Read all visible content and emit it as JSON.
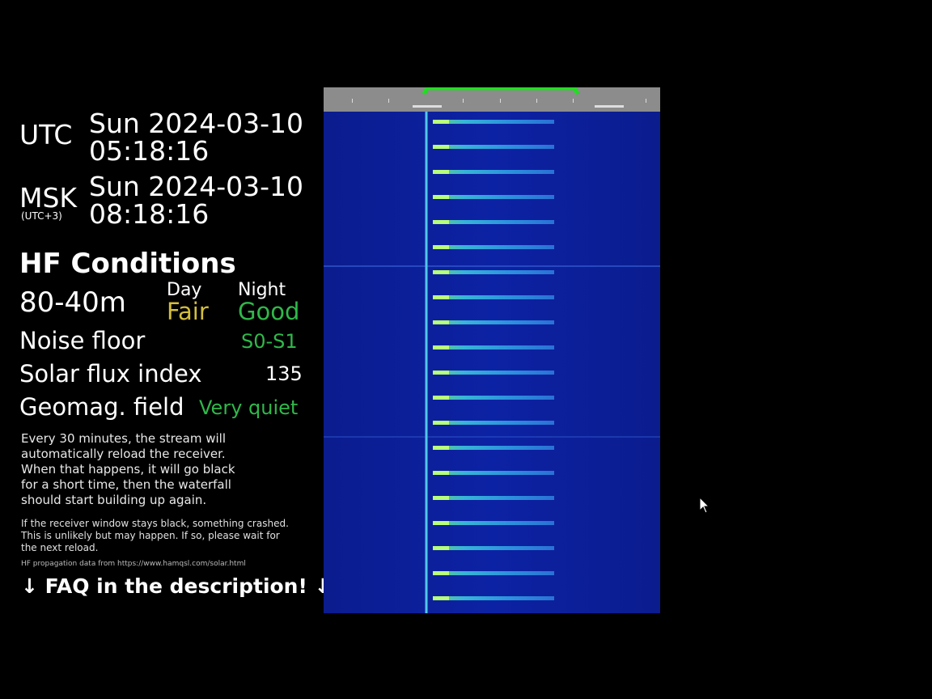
{
  "clock": {
    "utc_label": "UTC",
    "utc_date": "Sun 2024-03-10",
    "utc_time": "05:18:16",
    "msk_label": "MSK",
    "msk_sub": "(UTC+3)",
    "msk_date": "Sun 2024-03-10",
    "msk_time": "08:18:16"
  },
  "conditions": {
    "title": "HF Conditions",
    "band": "80-40m",
    "day_label": "Day",
    "night_label": "Night",
    "day_value": "Fair",
    "night_value": "Good",
    "noise_label": "Noise floor",
    "noise_value": "S0-S1",
    "sfi_label": "Solar flux index",
    "sfi_value": "135",
    "geomag_label": "Geomag. field",
    "geomag_value": "Very quiet"
  },
  "notes": {
    "reload": [
      "Every 30 minutes, the stream will",
      "automatically reload the receiver.",
      "When that happens, it will go black",
      "for a short time, then the waterfall",
      "should start building up again."
    ],
    "crash": [
      "If the receiver window stays black, something crashed.",
      "This is unlikely but may happen. If so, please wait for",
      "the next reload."
    ],
    "source": "HF propagation data from https://www.hamqsl.com/solar.html",
    "faq": "↓ FAQ in the description! ↓"
  },
  "colors": {
    "yellow": "#d4be3c",
    "green": "#2fb84a",
    "waterfall_bg": "#0a1a8c",
    "passband": "#22dd22"
  }
}
